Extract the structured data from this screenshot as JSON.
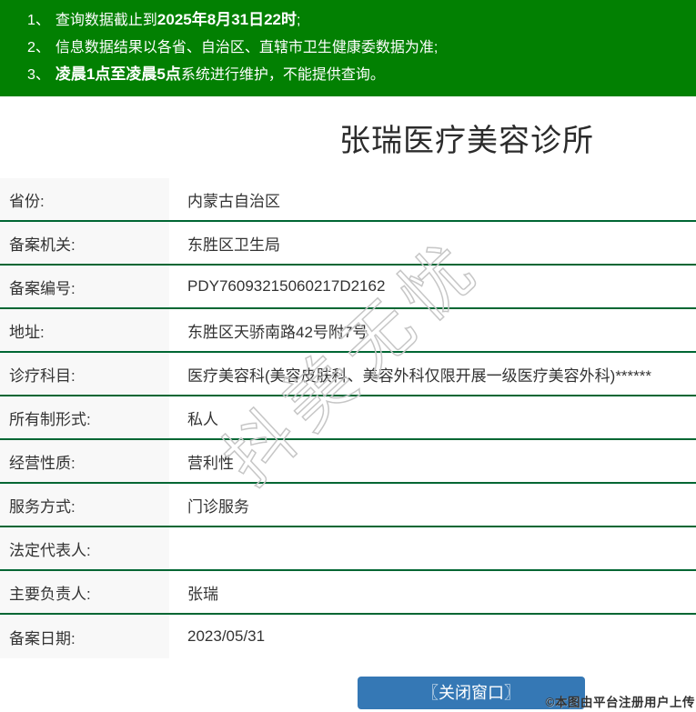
{
  "notice": {
    "items": [
      {
        "num": "1、",
        "pre": "查询数据截止到",
        "bold": "2025年8月31日22时",
        "post": ";"
      },
      {
        "num": "2、",
        "pre": "信息数据结果以各省、自治区、直辖市卫生健康委数据为准;",
        "bold": "",
        "post": ""
      },
      {
        "num": "3、",
        "pre": "",
        "bold": "凌晨1点至凌晨5点",
        "post": "系统进行维护，不能提供查询。"
      }
    ]
  },
  "title": "张瑞医疗美容诊所",
  "table": {
    "rows": [
      {
        "label": "省份:",
        "value": "内蒙古自治区"
      },
      {
        "label": "备案机关:",
        "value": "东胜区卫生局"
      },
      {
        "label": "备案编号:",
        "value": "PDY76093215060217D2162"
      },
      {
        "label": "地址:",
        "value": "东胜区天骄南路42号附7号"
      },
      {
        "label": "诊疗科目:",
        "value": "医疗美容科(美容皮肤科、美容外科仅限开展一级医疗美容外科)******"
      },
      {
        "label": "所有制形式:",
        "value": "私人"
      },
      {
        "label": "经营性质:",
        "value": "营利性"
      },
      {
        "label": "服务方式:",
        "value": "门诊服务"
      },
      {
        "label": "法定代表人:",
        "value": ""
      },
      {
        "label": "主要负责人:",
        "value": "张瑞"
      },
      {
        "label": "备案日期:",
        "value": "2023/05/31"
      }
    ]
  },
  "close_button_label": "〖关闭窗口〗",
  "watermark": {
    "text": "抖美无忧"
  },
  "credit_watermark": "©本图由平台注册用户上传",
  "colors": {
    "banner_green": "#028002",
    "divider_green": "#006633",
    "button_blue": "#3578b5",
    "label_bg": "#f8f8f8"
  }
}
